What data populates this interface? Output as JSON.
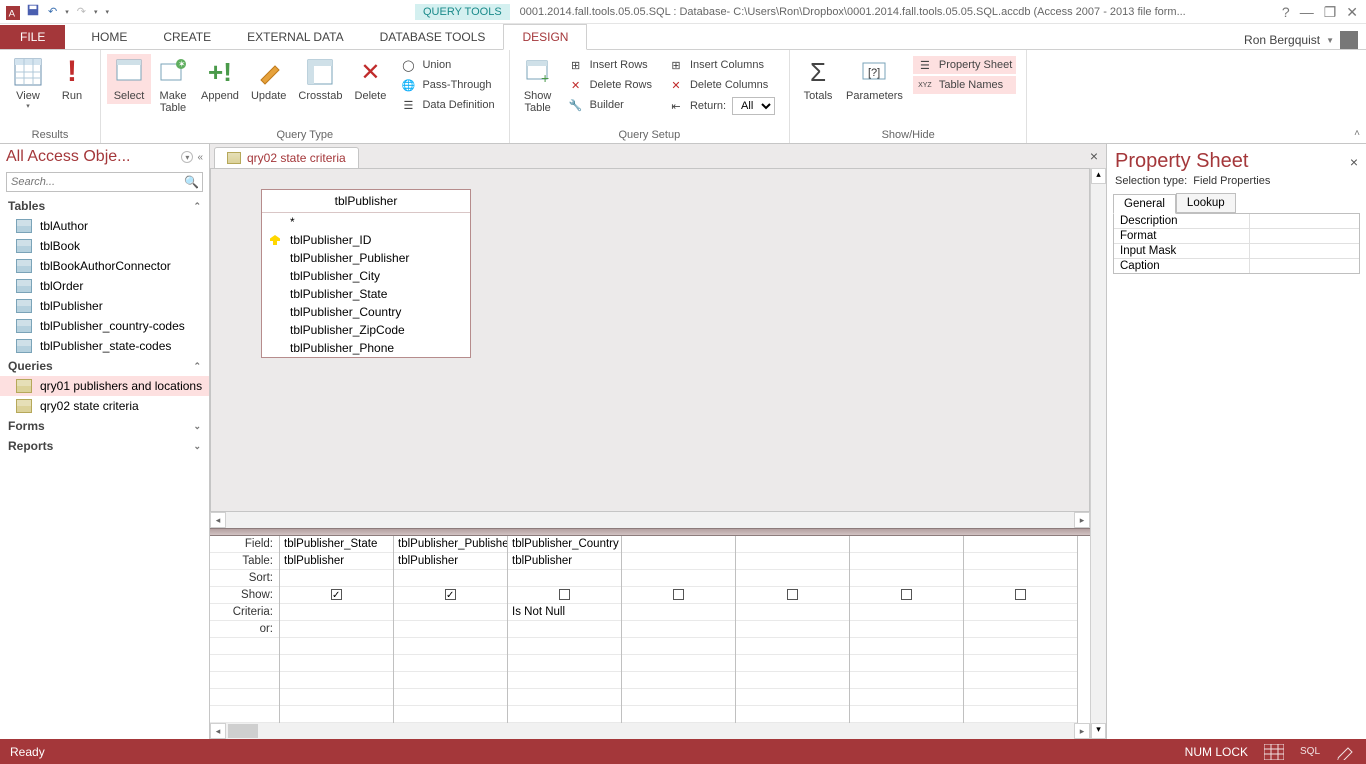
{
  "titlebar": {
    "context_tab": "QUERY TOOLS",
    "doc_title": "0001.2014.fall.tools.05.05.SQL : Database- C:\\Users\\Ron\\Dropbox\\0001.2014.fall.tools.05.05.SQL.accdb (Access 2007 - 2013 file form...",
    "user_name": "Ron Bergquist"
  },
  "tabs": {
    "file": "FILE",
    "home": "HOME",
    "create": "CREATE",
    "external": "EXTERNAL DATA",
    "dbtools": "DATABASE TOOLS",
    "design": "DESIGN"
  },
  "ribbon": {
    "results": {
      "view": "View",
      "run": "Run",
      "label": "Results"
    },
    "qtype": {
      "select": "Select",
      "make": "Make\nTable",
      "append": "Append",
      "update": "Update",
      "crosstab": "Crosstab",
      "delete": "Delete",
      "union": "Union",
      "pass": "Pass-Through",
      "datadef": "Data Definition",
      "label": "Query Type"
    },
    "qsetup": {
      "showtable": "Show\nTable",
      "ins_rows": "Insert Rows",
      "del_rows": "Delete Rows",
      "builder": "Builder",
      "ins_cols": "Insert Columns",
      "del_cols": "Delete Columns",
      "return": "Return:",
      "return_value": "All",
      "label": "Query Setup"
    },
    "showhide": {
      "totals": "Totals",
      "params": "Parameters",
      "propsheet": "Property Sheet",
      "tablenames": "Table Names",
      "label": "Show/Hide"
    }
  },
  "nav": {
    "title": "All Access Obje...",
    "search_placeholder": "Search...",
    "groups": {
      "tables": "Tables",
      "queries": "Queries",
      "forms": "Forms",
      "reports": "Reports"
    },
    "tables": [
      "tblAuthor",
      "tblBook",
      "tblBookAuthorConnector",
      "tblOrder",
      "tblPublisher",
      "tblPublisher_country-codes",
      "tblPublisher_state-codes"
    ],
    "queries": [
      "qry01 publishers and locations",
      "qry02 state criteria"
    ]
  },
  "doc_tab": "qry02 state criteria",
  "table_box": {
    "name": "tblPublisher",
    "star": "*",
    "fields": [
      "tblPublisher_ID",
      "tblPublisher_Publisher",
      "tblPublisher_City",
      "tblPublisher_State",
      "tblPublisher_Country",
      "tblPublisher_ZipCode",
      "tblPublisher_Phone"
    ]
  },
  "grid": {
    "labels": {
      "field": "Field:",
      "table": "Table:",
      "sort": "Sort:",
      "show": "Show:",
      "criteria": "Criteria:",
      "or": "or:"
    },
    "cols": [
      {
        "field": "tblPublisher_State",
        "table": "tblPublisher",
        "show": true,
        "criteria": ""
      },
      {
        "field": "tblPublisher_Publisher",
        "table": "tblPublisher",
        "show": true,
        "criteria": ""
      },
      {
        "field": "tblPublisher_Country",
        "table": "tblPublisher",
        "show": false,
        "criteria": "Is Not Null"
      },
      {
        "field": "",
        "table": "",
        "show": false,
        "criteria": ""
      },
      {
        "field": "",
        "table": "",
        "show": false,
        "criteria": ""
      },
      {
        "field": "",
        "table": "",
        "show": false,
        "criteria": ""
      },
      {
        "field": "",
        "table": "",
        "show": false,
        "criteria": ""
      }
    ]
  },
  "propsheet": {
    "title": "Property Sheet",
    "seltype_label": "Selection type:",
    "seltype_value": "Field Properties",
    "tabs": {
      "general": "General",
      "lookup": "Lookup"
    },
    "props": [
      "Description",
      "Format",
      "Input Mask",
      "Caption"
    ]
  },
  "status": {
    "ready": "Ready",
    "numlock": "NUM LOCK"
  }
}
